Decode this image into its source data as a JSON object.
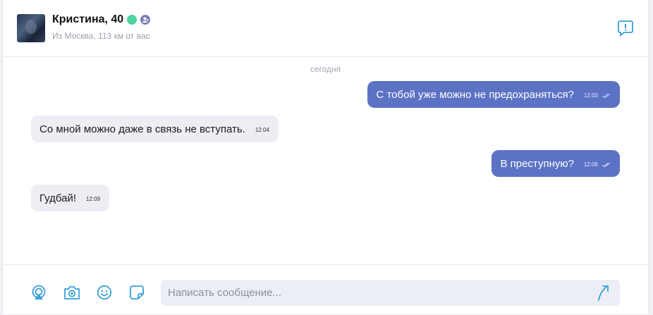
{
  "contact": {
    "name": "Кристина, 40",
    "location": "Из Москва, 113 км от вас"
  },
  "chat": {
    "date_label": "сегодня",
    "messages": [
      {
        "direction": "out",
        "text": "С тобой уже можно не предохраняться?",
        "time": "12:03"
      },
      {
        "direction": "in",
        "text": "Со мной можно даже в связь не вступать.",
        "time": "12:04"
      },
      {
        "direction": "out",
        "text": "В преступную?",
        "time": "12:06"
      },
      {
        "direction": "in",
        "text": "Гудбай!",
        "time": "12:09"
      }
    ]
  },
  "composer": {
    "placeholder": "Написать сообщение...",
    "tools": [
      "stream-icon",
      "camera-icon",
      "emoji-icon",
      "sticker-icon"
    ],
    "send_icon": "send-icon"
  },
  "colors": {
    "outgoing_bubble": "#5c72c4",
    "incoming_bubble": "#eceef4",
    "online": "#4cd3a0",
    "accent": "#3aa0d8"
  }
}
